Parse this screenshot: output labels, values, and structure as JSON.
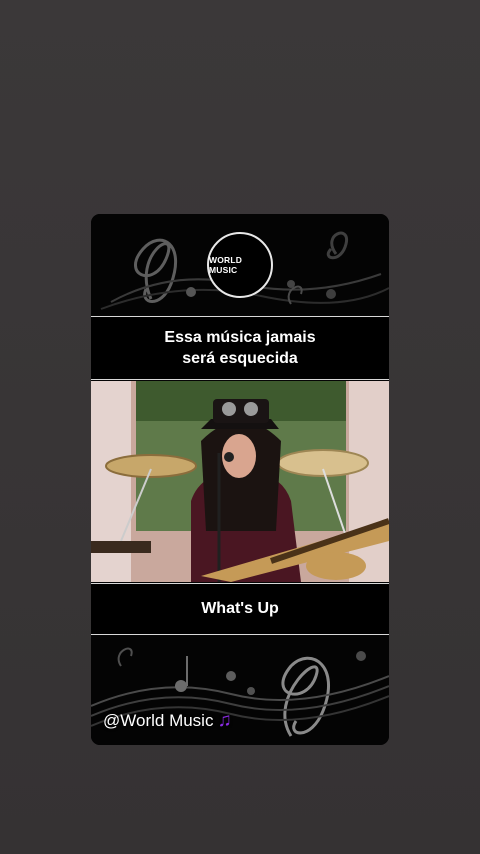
{
  "card": {
    "logo_text": "WORLD MUSIC",
    "headline_line1": "Essa música jamais",
    "headline_line2": "será esquecida",
    "song_title": "What's Up",
    "handle": "@World Music",
    "handle_icon": "musical-notes-icon"
  },
  "colors": {
    "background": "#3a3738",
    "card": "#050505",
    "text": "#ffffff",
    "divider": "#d8d8d8",
    "emoji": "#8a2be2"
  }
}
